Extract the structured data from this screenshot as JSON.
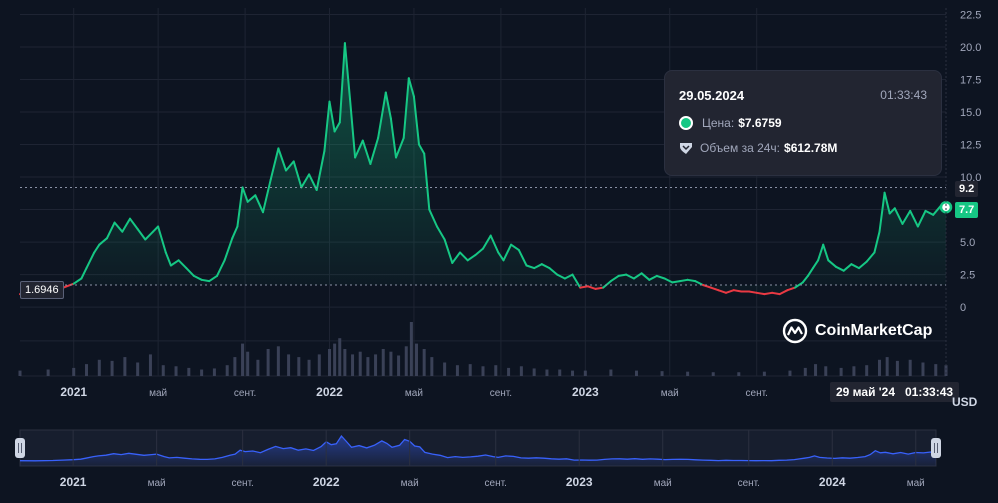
{
  "chart_data": {
    "type": "area",
    "currency": "USD",
    "y_ticks": [
      "0",
      "2.5",
      "5.0",
      "7.5",
      "10.0",
      "12.5",
      "15.0",
      "17.5",
      "20.0",
      "22.5"
    ],
    "ylim": [
      -5.3,
      23
    ],
    "x_ticks": [
      {
        "label": "2021",
        "t": 2021.0
      },
      {
        "label": "май",
        "t": 2021.33
      },
      {
        "label": "сент.",
        "t": 2021.67
      },
      {
        "label": "2022",
        "t": 2022.0
      },
      {
        "label": "май",
        "t": 2022.33
      },
      {
        "label": "сент.",
        "t": 2022.67
      },
      {
        "label": "2023",
        "t": 2023.0
      },
      {
        "label": "май",
        "t": 2023.33
      },
      {
        "label": "сент.",
        "t": 2023.67
      }
    ],
    "nav_ticks": [
      {
        "label": "2021",
        "t": 2021.0
      },
      {
        "label": "май",
        "t": 2021.33
      },
      {
        "label": "сент.",
        "t": 2021.67
      },
      {
        "label": "2022",
        "t": 2022.0
      },
      {
        "label": "май",
        "t": 2022.33
      },
      {
        "label": "сент.",
        "t": 2022.67
      },
      {
        "label": "2023",
        "t": 2023.0
      },
      {
        "label": "май",
        "t": 2023.33
      },
      {
        "label": "сент.",
        "t": 2023.67
      },
      {
        "label": "2024",
        "t": 2024.0
      },
      {
        "label": "май",
        "t": 2024.33
      }
    ],
    "reference_price": 1.6946,
    "reference_label": "1.6946",
    "high_label": "9.2",
    "high_value": 9.2,
    "current_label": "7.7",
    "current_value": 7.68,
    "price_series": [
      [
        2020.79,
        1.0
      ],
      [
        2020.85,
        0.9
      ],
      [
        2020.92,
        1.2
      ],
      [
        2020.96,
        1.5
      ],
      [
        2021.0,
        1.8
      ],
      [
        2021.03,
        2.2
      ],
      [
        2021.05,
        3.0
      ],
      [
        2021.08,
        4.2
      ],
      [
        2021.1,
        4.8
      ],
      [
        2021.13,
        5.3
      ],
      [
        2021.16,
        6.5
      ],
      [
        2021.19,
        5.8
      ],
      [
        2021.22,
        6.8
      ],
      [
        2021.25,
        6.0
      ],
      [
        2021.28,
        5.2
      ],
      [
        2021.31,
        5.8
      ],
      [
        2021.33,
        6.2
      ],
      [
        2021.36,
        4.2
      ],
      [
        2021.38,
        3.2
      ],
      [
        2021.41,
        3.6
      ],
      [
        2021.44,
        3.0
      ],
      [
        2021.47,
        2.4
      ],
      [
        2021.5,
        2.1
      ],
      [
        2021.53,
        2.0
      ],
      [
        2021.56,
        2.4
      ],
      [
        2021.59,
        3.6
      ],
      [
        2021.62,
        5.3
      ],
      [
        2021.64,
        6.2
      ],
      [
        2021.66,
        9.2
      ],
      [
        2021.68,
        8.1
      ],
      [
        2021.71,
        8.6
      ],
      [
        2021.74,
        7.3
      ],
      [
        2021.77,
        9.8
      ],
      [
        2021.8,
        12.2
      ],
      [
        2021.83,
        10.5
      ],
      [
        2021.86,
        11.2
      ],
      [
        2021.89,
        9.2
      ],
      [
        2021.92,
        10.2
      ],
      [
        2021.95,
        9.0
      ],
      [
        2021.98,
        12.0
      ],
      [
        2022.0,
        15.8
      ],
      [
        2022.02,
        13.5
      ],
      [
        2022.04,
        14.2
      ],
      [
        2022.06,
        20.3
      ],
      [
        2022.08,
        16.0
      ],
      [
        2022.1,
        11.5
      ],
      [
        2022.13,
        12.8
      ],
      [
        2022.16,
        11.0
      ],
      [
        2022.19,
        13.0
      ],
      [
        2022.22,
        16.5
      ],
      [
        2022.24,
        14.5
      ],
      [
        2022.26,
        11.5
      ],
      [
        2022.29,
        13.0
      ],
      [
        2022.31,
        17.6
      ],
      [
        2022.33,
        16.2
      ],
      [
        2022.35,
        12.5
      ],
      [
        2022.37,
        11.8
      ],
      [
        2022.39,
        7.5
      ],
      [
        2022.42,
        6.2
      ],
      [
        2022.45,
        5.2
      ],
      [
        2022.48,
        3.4
      ],
      [
        2022.51,
        4.2
      ],
      [
        2022.54,
        3.6
      ],
      [
        2022.57,
        4.0
      ],
      [
        2022.6,
        4.5
      ],
      [
        2022.63,
        5.5
      ],
      [
        2022.66,
        4.2
      ],
      [
        2022.68,
        3.6
      ],
      [
        2022.71,
        4.8
      ],
      [
        2022.74,
        4.4
      ],
      [
        2022.77,
        3.2
      ],
      [
        2022.8,
        3.0
      ],
      [
        2022.83,
        3.3
      ],
      [
        2022.86,
        3.0
      ],
      [
        2022.89,
        2.5
      ],
      [
        2022.92,
        2.2
      ],
      [
        2022.95,
        2.5
      ],
      [
        2022.98,
        1.5
      ],
      [
        2023.01,
        1.6
      ],
      [
        2023.04,
        1.4
      ],
      [
        2023.07,
        1.5
      ],
      [
        2023.1,
        2.0
      ],
      [
        2023.13,
        2.4
      ],
      [
        2023.16,
        2.5
      ],
      [
        2023.19,
        2.2
      ],
      [
        2023.22,
        2.6
      ],
      [
        2023.25,
        2.1
      ],
      [
        2023.28,
        2.4
      ],
      [
        2023.31,
        2.2
      ],
      [
        2023.34,
        1.9
      ],
      [
        2023.37,
        2.0
      ],
      [
        2023.4,
        2.1
      ],
      [
        2023.43,
        2.0
      ],
      [
        2023.46,
        1.7
      ],
      [
        2023.49,
        1.5
      ],
      [
        2023.52,
        1.3
      ],
      [
        2023.55,
        1.1
      ],
      [
        2023.58,
        1.3
      ],
      [
        2023.61,
        1.2
      ],
      [
        2023.64,
        1.2
      ],
      [
        2023.67,
        1.1
      ],
      [
        2023.7,
        1.0
      ],
      [
        2023.73,
        1.1
      ],
      [
        2023.76,
        1.0
      ],
      [
        2023.79,
        1.3
      ],
      [
        2023.82,
        1.5
      ],
      [
        2023.85,
        1.9
      ],
      [
        2023.87,
        2.4
      ],
      [
        2023.89,
        3.0
      ],
      [
        2023.91,
        3.6
      ],
      [
        2023.93,
        4.8
      ],
      [
        2023.95,
        3.6
      ],
      [
        2023.98,
        3.1
      ],
      [
        2024.01,
        2.8
      ],
      [
        2024.04,
        3.3
      ],
      [
        2024.07,
        3.0
      ],
      [
        2024.1,
        3.5
      ],
      [
        2024.13,
        4.2
      ],
      [
        2024.15,
        5.8
      ],
      [
        2024.17,
        8.8
      ],
      [
        2024.19,
        7.2
      ],
      [
        2024.21,
        7.6
      ],
      [
        2024.24,
        6.4
      ],
      [
        2024.27,
        7.4
      ],
      [
        2024.3,
        6.2
      ],
      [
        2024.33,
        7.4
      ],
      [
        2024.36,
        7.1
      ],
      [
        2024.39,
        7.8
      ],
      [
        2024.41,
        7.68
      ]
    ],
    "volume_series": [
      [
        2020.79,
        0.1
      ],
      [
        2020.9,
        0.12
      ],
      [
        2021.0,
        0.15
      ],
      [
        2021.05,
        0.22
      ],
      [
        2021.1,
        0.3
      ],
      [
        2021.15,
        0.28
      ],
      [
        2021.2,
        0.35
      ],
      [
        2021.25,
        0.25
      ],
      [
        2021.3,
        0.4
      ],
      [
        2021.35,
        0.2
      ],
      [
        2021.4,
        0.18
      ],
      [
        2021.45,
        0.15
      ],
      [
        2021.5,
        0.12
      ],
      [
        2021.55,
        0.14
      ],
      [
        2021.6,
        0.2
      ],
      [
        2021.63,
        0.35
      ],
      [
        2021.66,
        0.6
      ],
      [
        2021.68,
        0.45
      ],
      [
        2021.72,
        0.3
      ],
      [
        2021.76,
        0.5
      ],
      [
        2021.8,
        0.55
      ],
      [
        2021.84,
        0.4
      ],
      [
        2021.88,
        0.35
      ],
      [
        2021.92,
        0.3
      ],
      [
        2021.96,
        0.4
      ],
      [
        2022.0,
        0.5
      ],
      [
        2022.02,
        0.6
      ],
      [
        2022.04,
        0.7
      ],
      [
        2022.06,
        0.5
      ],
      [
        2022.09,
        0.4
      ],
      [
        2022.12,
        0.45
      ],
      [
        2022.15,
        0.35
      ],
      [
        2022.18,
        0.4
      ],
      [
        2022.21,
        0.5
      ],
      [
        2022.24,
        0.45
      ],
      [
        2022.27,
        0.38
      ],
      [
        2022.3,
        0.55
      ],
      [
        2022.32,
        1.0
      ],
      [
        2022.34,
        0.6
      ],
      [
        2022.37,
        0.5
      ],
      [
        2022.4,
        0.35
      ],
      [
        2022.45,
        0.25
      ],
      [
        2022.5,
        0.2
      ],
      [
        2022.55,
        0.22
      ],
      [
        2022.6,
        0.18
      ],
      [
        2022.65,
        0.2
      ],
      [
        2022.7,
        0.15
      ],
      [
        2022.75,
        0.18
      ],
      [
        2022.8,
        0.14
      ],
      [
        2022.85,
        0.12
      ],
      [
        2022.9,
        0.12
      ],
      [
        2022.95,
        0.1
      ],
      [
        2023.0,
        0.1
      ],
      [
        2023.1,
        0.12
      ],
      [
        2023.2,
        0.1
      ],
      [
        2023.3,
        0.09
      ],
      [
        2023.4,
        0.08
      ],
      [
        2023.5,
        0.07
      ],
      [
        2023.6,
        0.07
      ],
      [
        2023.7,
        0.08
      ],
      [
        2023.8,
        0.1
      ],
      [
        2023.86,
        0.15
      ],
      [
        2023.9,
        0.22
      ],
      [
        2023.94,
        0.18
      ],
      [
        2024.0,
        0.15
      ],
      [
        2024.05,
        0.18
      ],
      [
        2024.1,
        0.2
      ],
      [
        2024.15,
        0.3
      ],
      [
        2024.18,
        0.35
      ],
      [
        2024.22,
        0.28
      ],
      [
        2024.27,
        0.3
      ],
      [
        2024.32,
        0.25
      ],
      [
        2024.37,
        0.22
      ],
      [
        2024.41,
        0.2
      ]
    ]
  },
  "tooltip": {
    "date": "29.05.2024",
    "time": "01:33:43",
    "price_label": "Цена:",
    "price_value": "$7.6759",
    "volume_label": "Объем за 24ч:",
    "volume_value": "$612.78M"
  },
  "crosshair": {
    "date": "29 май '24",
    "time": "01:33:43"
  },
  "currency_label": "USD",
  "brand": "CoinMarketCap",
  "colors": {
    "background": "#0d1421",
    "up": "#16c784",
    "down": "#ea3943",
    "grid": "#1e2433",
    "volume": "#3a4157",
    "navigator_line": "#3861fb"
  }
}
